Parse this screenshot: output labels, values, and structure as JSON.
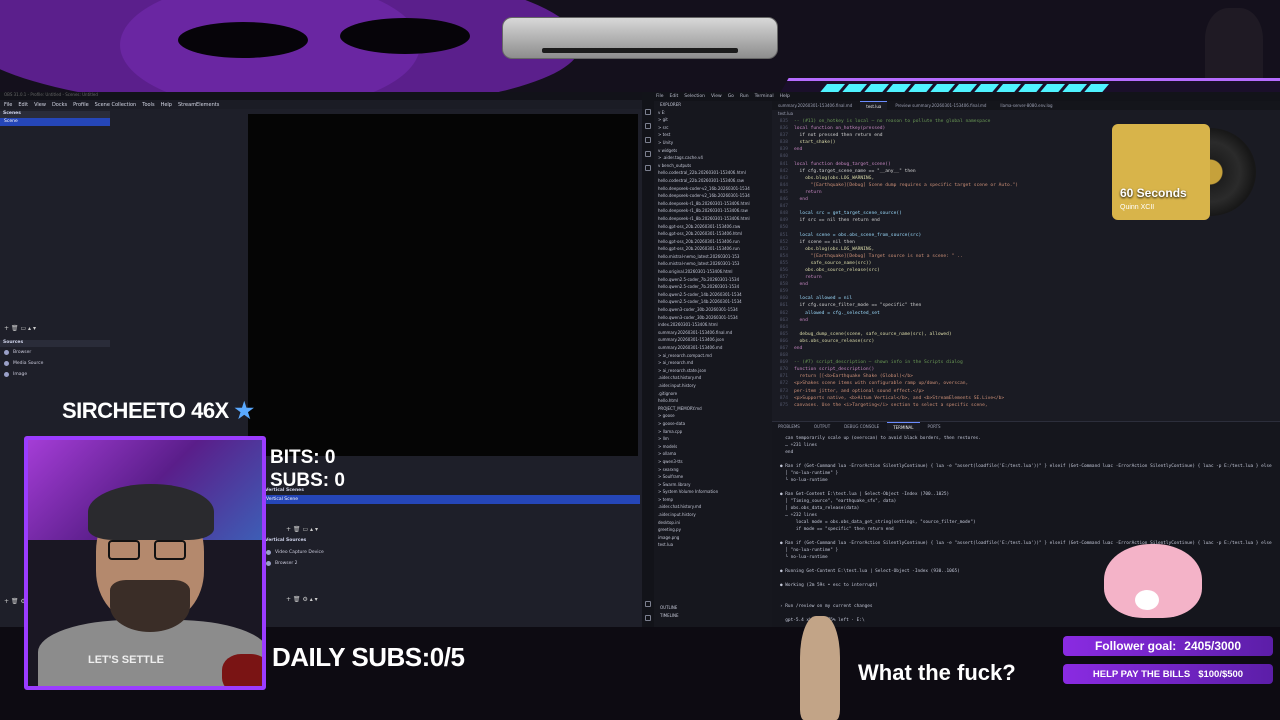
{
  "obs": {
    "title": "OBS 31.0.1 - Profile: Untitled - Scenes: Untitled",
    "menu": [
      "File",
      "Edit",
      "View",
      "Docks",
      "Profile",
      "Scene Collection",
      "Tools",
      "Help",
      "StreamElements"
    ],
    "scenes_title": "Scenes",
    "scene_selected": "Scene",
    "sources_title": "Sources",
    "sources": [
      "Browser",
      "Media Source",
      "Image"
    ],
    "vertical_scenes_title": "Vertical Scenes",
    "vertical_scene": "Vertical Scene",
    "vertical_sources_title": "Vertical Sources",
    "vertical_sources": [
      "Video Capture Device",
      "Browser 2"
    ]
  },
  "vscode": {
    "menu": [
      "File",
      "Edit",
      "Selection",
      "View",
      "Go",
      "Run",
      "Terminal",
      "Help"
    ],
    "tabs": [
      "summary.20260301-153406.final.md",
      "test.lua",
      "Preview summary.20260301-153406.final.md",
      "llama-server-8080.env.log"
    ],
    "explorer_title": "EXPLORER",
    "explorer_items": [
      "v E:",
      "  > git",
      "    > src",
      "    > test",
      "    > Unity",
      "    v widgets",
      "      > .aider.tags.cache.v4",
      "      v bench_outputs",
      "        hello.codestral_22b.20260301-153406.html",
      "        hello.codestral_22b.20260301-153406.raw",
      "        hello.deepseek-coder-v2_16b.20260301-1534",
      "        hello.deepseek-coder-v2_16b.20260301-1534",
      "        hello.deepseek-r1_8b.20260301-153406.html",
      "        hello.deepseek-r1_8b.20260301-153406.raw",
      "        hello.deepseek-r1_8b.20260301-153406.html",
      "        hello.gpt-oss_20b.20260301-153406.raw",
      "        hello.gpt-oss_20b.20260301-153406.html",
      "        hello.gpt-oss_20b.20260301-153406.run",
      "        hello.gpt-oss_20b.20260301-153406.run",
      "        hello.mistral-nemo_latest.20260301-153",
      "        hello.mistral-nemo_latest.20260301-153",
      "        hello.original.20260301-153406.html",
      "        hello.qwen2.5-coder_7b.20260301-1534",
      "        hello.qwen2.5-coder_7b.20260301-1534",
      "        hello.qwen2.5-coder_14b.20260301-1534",
      "        hello.qwen2.5-coder_14b.20260301-1534",
      "        hello.qwen3-coder_30b.20260301-1534",
      "        hello.qwen3-coder_30b.20260301-1534",
      "        index.20260301-153406.html",
      "        summary.20260301-153406.final.md",
      "        summary.20260301-153406.json",
      "        summary.20260301-153406.md",
      "      > ai_research.compact.md",
      "      > ai_research.md",
      "      > ai_research.state.json",
      "      .aider.chat.history.md",
      "      .aider.input.history",
      "      .gitignore",
      "      hello.html",
      "      PROJECT_MEMORY.md",
      "    > goose",
      "    > goose-data",
      "    > llama.cpp",
      "    > llm",
      "    > models",
      "    > ollama",
      "    > qwen3-tts",
      "    > searxng",
      "    > Soulframe",
      "    > Swarm.library",
      "    > System Volume Information",
      "    > temp",
      "    .aider.chat.history.md",
      "    .aider.input.history",
      "    desktop.ini",
      "    greeting.py",
      "    image.png",
      "    test.lua"
    ],
    "outline": "OUTLINE",
    "timeline": "TIMELINE",
    "code": [
      {
        "n": "835",
        "t": "-- (#11) on_hotkey is local — no reason to pollute the global namespace",
        "c": "#6a9955"
      },
      {
        "n": "836",
        "t": "local function on_hotkey(pressed)",
        "c": "#c586c0"
      },
      {
        "n": "837",
        "t": "  if not pressed then return end",
        "c": "#d4d4d4"
      },
      {
        "n": "838",
        "t": "  start_shake()",
        "c": "#dcdcaa"
      },
      {
        "n": "839",
        "t": "end",
        "c": "#c586c0"
      },
      {
        "n": "840",
        "t": "",
        "c": "#d4d4d4"
      },
      {
        "n": "841",
        "t": "local function debug_target_scene()",
        "c": "#c586c0"
      },
      {
        "n": "842",
        "t": "  if cfg.target_scene_name == \"__any__\" then",
        "c": "#d4d4d4"
      },
      {
        "n": "843",
        "t": "    obs.blog(obs.LOG_WARNING,",
        "c": "#dcdcaa"
      },
      {
        "n": "844",
        "t": "      \"[Earthquake][Debug] Scene dump requires a specific target scene or Auto.\")",
        "c": "#ce9178"
      },
      {
        "n": "845",
        "t": "    return",
        "c": "#c586c0"
      },
      {
        "n": "846",
        "t": "  end",
        "c": "#c586c0"
      },
      {
        "n": "847",
        "t": "",
        "c": "#d4d4d4"
      },
      {
        "n": "848",
        "t": "  local src = get_target_scene_source()",
        "c": "#9cdcfe"
      },
      {
        "n": "849",
        "t": "  if src == nil then return end",
        "c": "#d4d4d4"
      },
      {
        "n": "850",
        "t": "",
        "c": "#d4d4d4"
      },
      {
        "n": "851",
        "t": "  local scene = obs.obs_scene_from_source(src)",
        "c": "#9cdcfe"
      },
      {
        "n": "852",
        "t": "  if scene == nil then",
        "c": "#d4d4d4"
      },
      {
        "n": "853",
        "t": "    obs.blog(obs.LOG_WARNING,",
        "c": "#dcdcaa"
      },
      {
        "n": "854",
        "t": "      \"[Earthquake][Debug] Target source is not a scene: \" ..",
        "c": "#ce9178"
      },
      {
        "n": "855",
        "t": "      safe_source_name(src))",
        "c": "#dcdcaa"
      },
      {
        "n": "856",
        "t": "    obs.obs_source_release(src)",
        "c": "#dcdcaa"
      },
      {
        "n": "857",
        "t": "    return",
        "c": "#c586c0"
      },
      {
        "n": "858",
        "t": "  end",
        "c": "#c586c0"
      },
      {
        "n": "859",
        "t": "",
        "c": "#d4d4d4"
      },
      {
        "n": "860",
        "t": "  local allowed = nil",
        "c": "#9cdcfe"
      },
      {
        "n": "861",
        "t": "  if cfg.source_filter_mode == \"specific\" then",
        "c": "#d4d4d4"
      },
      {
        "n": "862",
        "t": "    allowed = cfg._selected_set",
        "c": "#9cdcfe"
      },
      {
        "n": "863",
        "t": "  end",
        "c": "#c586c0"
      },
      {
        "n": "864",
        "t": "",
        "c": "#d4d4d4"
      },
      {
        "n": "865",
        "t": "  debug_dump_scene(scene, safe_source_name(src), allowed)",
        "c": "#dcdcaa"
      },
      {
        "n": "866",
        "t": "  obs.obs_source_release(src)",
        "c": "#dcdcaa"
      },
      {
        "n": "867",
        "t": "end",
        "c": "#c586c0"
      },
      {
        "n": "868",
        "t": "",
        "c": "#d4d4d4"
      },
      {
        "n": "869",
        "t": "-- (#7) script_description — shown info in the Scripts dialog",
        "c": "#6a9955"
      },
      {
        "n": "870",
        "t": "function script_description()",
        "c": "#c586c0"
      },
      {
        "n": "871",
        "t": "  return [[<b>Earthquake Shake (Global)</b>",
        "c": "#ce9178"
      },
      {
        "n": "872",
        "t": "<p>Shakes scene items with configurable ramp up/down, overscan,",
        "c": "#ce9178"
      },
      {
        "n": "873",
        "t": "per-item jitter, and optional sound effect.</p>",
        "c": "#ce9178"
      },
      {
        "n": "874",
        "t": "<p>Supports native, <b>Aitum Vertical</b>, and <b>StreamElements SE.Live</b>",
        "c": "#ce9178"
      },
      {
        "n": "875",
        "t": "canvases. Use the <i>Targeting</i> section to select a specific scene,",
        "c": "#ce9178"
      }
    ],
    "panel_tabs": [
      "PROBLEMS",
      "OUTPUT",
      "DEBUG CONSOLE",
      "TERMINAL",
      "PORTS"
    ],
    "terminal": [
      "  can temporarily scale up (overscan) to avoid black borders, then restores.",
      "  … +231 lines",
      "  end",
      "",
      "● Ran if (Get-Command lua -ErrorAction SilentlyContinue) { lua -e \"assert(loadfile('E:/test.lua'))\" } elseif (Get-Command luac -ErrorAction SilentlyContinue) { luac -p E:/test.lua } else",
      "  │ \"no-lua-runtime\" }",
      "  └ no-lua-runtime",
      "",
      "● Ran Get-Content E:\\test.lua | Select-Object -Index (700..1025)",
      "  │ \"Timing_source\", \"earthquake_sfx\", data)",
      "  │ obs.obs_data_release(data)",
      "  … +232 lines",
      "      local mode = obs.obs_data_get_string(settings, \"source_filter_mode\")",
      "      if mode == \"specific\" then return end",
      "",
      "● Ran if (Get-Command lua -ErrorAction SilentlyContinue) { lua -e \"assert(loadfile('E:/test.lua'))\" } elseif (Get-Command luac -ErrorAction SilentlyContinue) { luac -p E:/test.lua } else",
      "  │ \"no-lua-runtime\" }",
      "  └ no-lua-runtime",
      "",
      "● Running Get-Content E:\\test.lua | Select-Object -Index (930..1065)",
      "",
      "● Working (2m 59s • esc to interrupt)",
      "",
      "",
      "› Run /review on my current changes",
      "",
      "  gpt-5.4 xhigh · 75% left · E:\\"
    ]
  },
  "album": {
    "title": "60 Seconds",
    "artist": "Quinn XCII"
  },
  "overlay": {
    "streamer_name": "SIRCHEETO",
    "multiplier": "46X",
    "star_icon": "star-icon",
    "bits": "BITS: 0",
    "subs": "SUBS: 0",
    "daily_subs": "DAILY SUBS:0/5",
    "alert": "What the fuck?",
    "follower_goal_label": "Follower goal:",
    "follower_goal_value": "2405/3000",
    "bills_label": "HELP PAY THE BILLS",
    "bills_value": "$100/$500",
    "shirt_text": "LET'S SETTLE",
    "accent": "#9b3cff"
  }
}
